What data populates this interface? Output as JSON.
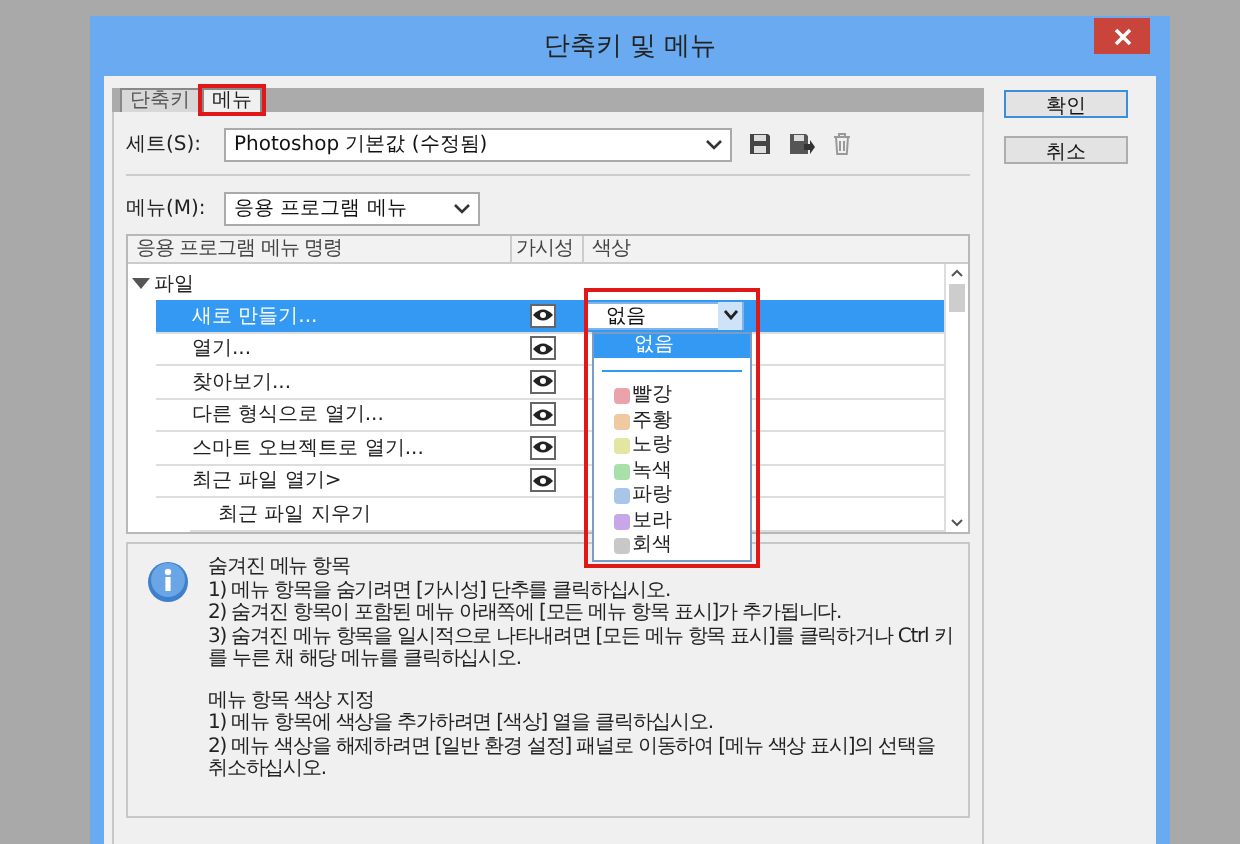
{
  "window": {
    "title": "단축키 및 메뉴"
  },
  "tabs": [
    {
      "label": "단축키",
      "selected": false,
      "highlighted": false
    },
    {
      "label": "메뉴",
      "selected": true,
      "highlighted": true
    }
  ],
  "set": {
    "label": "세트(S):",
    "value": "Photoshop 기본값 (수정됨)"
  },
  "menu": {
    "label": "메뉴(M):",
    "value": "응용 프로그램 메뉴"
  },
  "table": {
    "columns": [
      "응용 프로그램 메뉴 명령",
      "가시성",
      "색상"
    ],
    "rows": [
      {
        "label": "파일",
        "expanded": true,
        "children": [
          {
            "label": "새로 만들기...",
            "visible": true,
            "selected": true,
            "color_value": "없음"
          },
          {
            "label": "열기...",
            "visible": true,
            "selected": false
          },
          {
            "label": "찾아보기...",
            "visible": true,
            "selected": false
          },
          {
            "label": "다른 형식으로 열기...",
            "visible": true,
            "selected": false
          },
          {
            "label": "스마트 오브젝트로 열기...",
            "visible": true,
            "selected": false
          },
          {
            "label": "최근 파일 열기>",
            "visible": true,
            "selected": false,
            "children": [
              {
                "label": "최근 파일 지우기",
                "selected": false
              }
            ]
          }
        ]
      }
    ]
  },
  "color_dropdown": {
    "highlighted": true,
    "options": [
      {
        "label": "없음",
        "selected": true
      },
      {
        "label": "빨강",
        "color": "#eba3ab",
        "selected": false
      },
      {
        "label": "주황",
        "color": "#f0c9a2",
        "selected": false
      },
      {
        "label": "노랑",
        "color": "#e2e6a0",
        "selected": false
      },
      {
        "label": "녹색",
        "color": "#a9dfa9",
        "selected": false
      },
      {
        "label": "파랑",
        "color": "#a8c5ea",
        "selected": false
      },
      {
        "label": "보라",
        "color": "#c7a7e8",
        "selected": false
      },
      {
        "label": "회색",
        "color": "#c8c8c8",
        "selected": false
      }
    ]
  },
  "buttons": [
    "확인",
    "취소"
  ],
  "info": {
    "sections": [
      {
        "title": "숨겨진 메뉴 항목",
        "lines": [
          "1) 메뉴 항목을 숨기려면 [가시성] 단추를 클릭하십시오.",
          "2) 숨겨진 항목이 포함된 메뉴 아래쪽에 [모든 메뉴 항목 표시]가 추가됩니다.",
          "3) 숨겨진 메뉴 항목을 일시적으로 나타내려면 [모든 메뉴 항목 표시]를 클릭하거나 Ctrl 키를 누른 채 해당 메뉴를 클릭하십시오."
        ]
      },
      {
        "title": "메뉴 항목 색상 지정",
        "lines": [
          "1) 메뉴 항목에 색상을 추가하려면 [색상] 열을 클릭하십시오.",
          "2) 메뉴 색상을 해제하려면 [일반 환경 설정] 패널로 이동하여 [메뉴 색상 표시]의 선택을 취소하십시오."
        ]
      }
    ]
  }
}
